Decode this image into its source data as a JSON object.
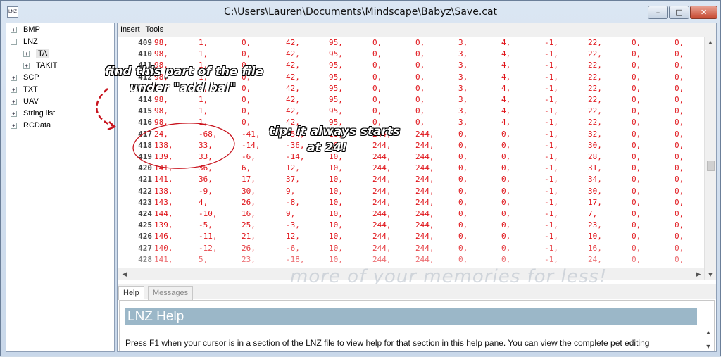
{
  "window": {
    "title": "C:\\Users\\Lauren\\Documents\\Mindscape\\Babyz\\Save.cat",
    "app_icon_text": "LNZ",
    "controls": {
      "min": "–",
      "max": "□",
      "close": "✕"
    }
  },
  "tree": [
    {
      "label": "BMP",
      "exp": "+",
      "indent": 0
    },
    {
      "label": "LNZ",
      "exp": "−",
      "indent": 0
    },
    {
      "label": "TA",
      "exp": "+",
      "indent": 1,
      "selected": true
    },
    {
      "label": "TAKIT",
      "exp": "+",
      "indent": 1
    },
    {
      "label": "SCP",
      "exp": "+",
      "indent": 0
    },
    {
      "label": "TXT",
      "exp": "+",
      "indent": 0
    },
    {
      "label": "UAV",
      "exp": "+",
      "indent": 0
    },
    {
      "label": "String list",
      "exp": "+",
      "indent": 0
    },
    {
      "label": "RCData",
      "exp": "+",
      "indent": 0
    }
  ],
  "menu": {
    "insert": "Insert",
    "tools": "Tools"
  },
  "rows": [
    {
      "ln": "409",
      "v": [
        "98,",
        "1,",
        "0,",
        "42,",
        "95,",
        "0,",
        "0,",
        "3,",
        "4,",
        "-1,",
        "22,",
        "0,",
        "0,"
      ]
    },
    {
      "ln": "410",
      "v": [
        "98,",
        "1,",
        "0,",
        "42,",
        "95,",
        "0,",
        "0,",
        "3,",
        "4,",
        "-1,",
        "22,",
        "0,",
        "0,"
      ]
    },
    {
      "ln": "411",
      "v": [
        "98,",
        "1,",
        "0,",
        "42,",
        "95,",
        "0,",
        "0,",
        "3,",
        "4,",
        "-1,",
        "22,",
        "0,",
        "0,"
      ]
    },
    {
      "ln": "412",
      "v": [
        "98,",
        "1,",
        "0,",
        "42,",
        "95,",
        "0,",
        "0,",
        "3,",
        "4,",
        "-1,",
        "22,",
        "0,",
        "0,"
      ]
    },
    {
      "ln": "413",
      "v": [
        "98,",
        "1,",
        "0,",
        "42,",
        "95,",
        "0,",
        "0,",
        "3,",
        "4,",
        "-1,",
        "22,",
        "0,",
        "0,"
      ]
    },
    {
      "ln": "414",
      "v": [
        "98,",
        "1,",
        "0,",
        "42,",
        "95,",
        "0,",
        "0,",
        "3,",
        "4,",
        "-1,",
        "22,",
        "0,",
        "0,"
      ]
    },
    {
      "ln": "415",
      "v": [
        "98,",
        "1,",
        "0,",
        "42,",
        "95,",
        "0,",
        "0,",
        "3,",
        "4,",
        "-1,",
        "22,",
        "0,",
        "0,"
      ]
    },
    {
      "ln": "416",
      "v": [
        "98,",
        "1,",
        "0,",
        "42,",
        "95,",
        "0,",
        "0,",
        "3,",
        "4,",
        "-1,",
        "22,",
        "0,",
        "0,"
      ]
    },
    {
      "ln": "417",
      "v": [
        "24,",
        "-68,",
        "-41,",
        "-54,",
        "10,",
        "244,",
        "244,",
        "0,",
        "0,",
        "-1,",
        "32,",
        "0,",
        "0,"
      ]
    },
    {
      "ln": "418",
      "v": [
        "138,",
        "33,",
        "-14,",
        "-36,",
        "10,",
        "244,",
        "244,",
        "0,",
        "0,",
        "-1,",
        "30,",
        "0,",
        "0,"
      ]
    },
    {
      "ln": "419",
      "v": [
        "139,",
        "33,",
        "-6,",
        "-14,",
        "10,",
        "244,",
        "244,",
        "0,",
        "0,",
        "-1,",
        "28,",
        "0,",
        "0,"
      ]
    },
    {
      "ln": "420",
      "v": [
        "141,",
        "36,",
        "6,",
        "12,",
        "10,",
        "244,",
        "244,",
        "0,",
        "0,",
        "-1,",
        "31,",
        "0,",
        "0,"
      ]
    },
    {
      "ln": "421",
      "v": [
        "141,",
        "36,",
        "17,",
        "37,",
        "10,",
        "244,",
        "244,",
        "0,",
        "0,",
        "-1,",
        "34,",
        "0,",
        "0,"
      ]
    },
    {
      "ln": "422",
      "v": [
        "138,",
        "-9,",
        "30,",
        "9,",
        "10,",
        "244,",
        "244,",
        "0,",
        "0,",
        "-1,",
        "30,",
        "0,",
        "0,"
      ]
    },
    {
      "ln": "423",
      "v": [
        "143,",
        "4,",
        "26,",
        "-8,",
        "10,",
        "244,",
        "244,",
        "0,",
        "0,",
        "-1,",
        "17,",
        "0,",
        "0,"
      ]
    },
    {
      "ln": "424",
      "v": [
        "144,",
        "-10,",
        "16,",
        "9,",
        "10,",
        "244,",
        "244,",
        "0,",
        "0,",
        "-1,",
        "7,",
        "0,",
        "0,"
      ]
    },
    {
      "ln": "425",
      "v": [
        "139,",
        "-5,",
        "25,",
        "-3,",
        "10,",
        "244,",
        "244,",
        "0,",
        "0,",
        "-1,",
        "23,",
        "0,",
        "0,"
      ]
    },
    {
      "ln": "426",
      "v": [
        "146,",
        "-11,",
        "21,",
        "12,",
        "10,",
        "244,",
        "244,",
        "0,",
        "0,",
        "-1,",
        "10,",
        "0,",
        "0,"
      ]
    },
    {
      "ln": "427",
      "v": [
        "140,",
        "-12,",
        "26,",
        "-6,",
        "10,",
        "244,",
        "244,",
        "0,",
        "0,",
        "-1,",
        "16,",
        "0,",
        "0,"
      ]
    },
    {
      "ln": "428",
      "v": [
        "141,",
        "5,",
        "23,",
        "-18,",
        "10,",
        "244,",
        "244,",
        "0,",
        "0,",
        "-1,",
        "24,",
        "0,",
        "0,"
      ]
    }
  ],
  "tabs": {
    "help": "Help",
    "messages": "Messages"
  },
  "help": {
    "heading": "LNZ Help",
    "text": "Press F1 when your cursor is in a section of the LNZ file to view help for that section in this help pane. You can view the complete pet editing"
  },
  "watermark": "more of your memories for less!",
  "annotations": {
    "find_line1": "find this part of the file",
    "find_line2": "under \"add bal\"",
    "tip_line1": "tip: it always starts",
    "tip_line2": "at 24!"
  },
  "colors": {
    "number": "#e0141a",
    "help_header": "#9bb7c8",
    "annotation_stroke": "#c8141e"
  }
}
